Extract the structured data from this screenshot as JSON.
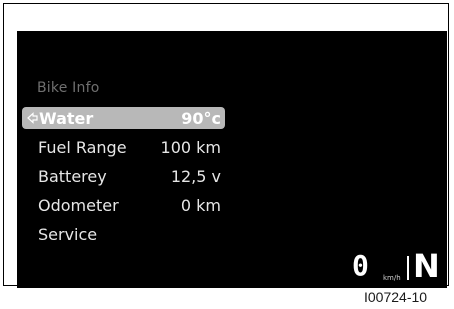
{
  "menu": {
    "title": "Bike Info",
    "items": [
      {
        "label": "Water",
        "value": "90°c",
        "selected": true
      },
      {
        "label": "Fuel Range",
        "value": "100 km",
        "selected": false
      },
      {
        "label": "Batterey",
        "value": "12,5 v",
        "selected": false
      },
      {
        "label": "Odometer",
        "value": "0 km",
        "selected": false
      },
      {
        "label": "Service",
        "value": "",
        "selected": false
      }
    ]
  },
  "status": {
    "speed": "0",
    "speed_unit": "km/h",
    "gear": "N"
  },
  "figure_ref": "I00724-10",
  "colors": {
    "screen_bg": "#000000",
    "selection_bg": "#b8b8b8",
    "title_text": "#6f6f6f",
    "item_text": "#e6e6e6"
  }
}
